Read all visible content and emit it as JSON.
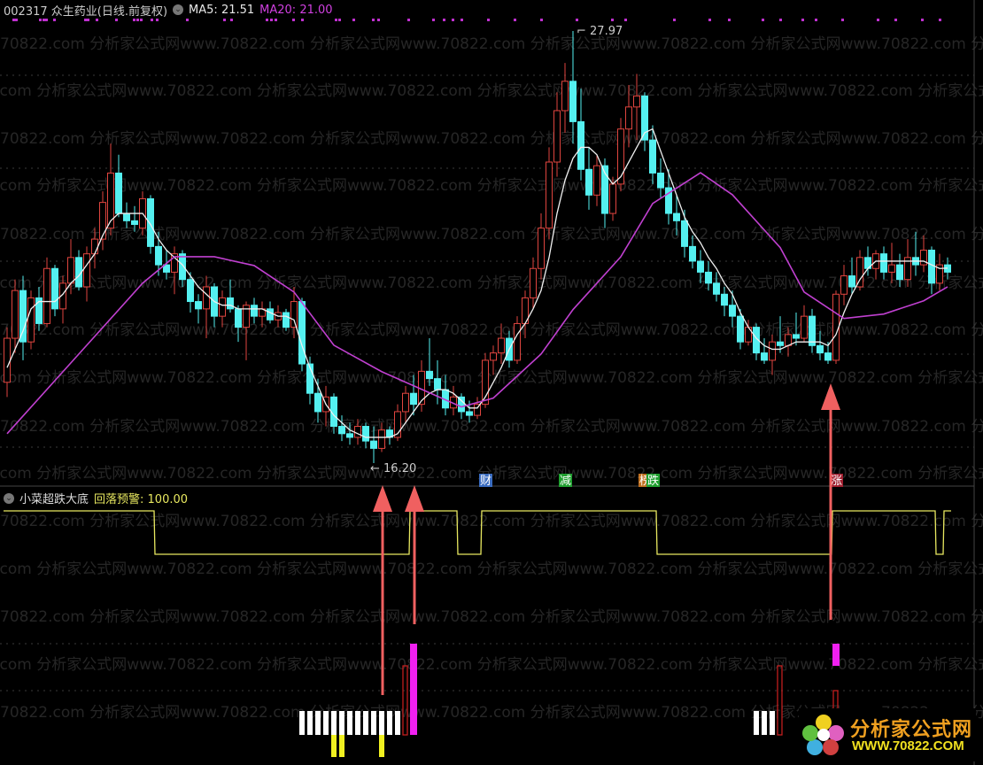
{
  "header": {
    "stock_title": "002317 众生药业(日线.前复权)",
    "ma5_label": "MA5: 21.51",
    "ma20_label": "MA20: 21.00"
  },
  "indicator": {
    "name": "小菜超跌大底",
    "value_label": "回落预警: 100.00"
  },
  "watermark": "70822.com 分析家公式网www.70822.com 分析家公式网www.70822.com 分析家公式网www.70822.com 分析家公式网www.70822.com 分析家公式网",
  "logo": {
    "title": "分析家公式网",
    "url": "WWW.70822.COM"
  },
  "colors": {
    "up": "#e0453f",
    "down": "#54f0f0",
    "ma5": "#f0f0f0",
    "ma20": "#c040d0",
    "alert": "#e8e860",
    "arrow": "#f06060",
    "magenta": "#f020f0"
  },
  "chart_data": {
    "type": "candlestick",
    "title": "002317 众生药业(日线.前复权)",
    "high_label": "27.97",
    "low_label": "16.20",
    "high_index": 71,
    "low_index": 46,
    "candles_ohlc": [
      [
        18.4,
        19.9,
        18.0,
        19.6
      ],
      [
        19.6,
        21.2,
        19.2,
        20.9
      ],
      [
        20.9,
        21.3,
        19.0,
        19.5
      ],
      [
        19.5,
        20.9,
        19.3,
        20.7
      ],
      [
        20.7,
        21.0,
        19.8,
        20.0
      ],
      [
        20.0,
        21.8,
        19.9,
        21.5
      ],
      [
        21.5,
        21.6,
        20.2,
        20.4
      ],
      [
        20.4,
        21.3,
        20.0,
        21.1
      ],
      [
        21.1,
        22.3,
        20.8,
        21.8
      ],
      [
        21.8,
        22.0,
        20.9,
        21.0
      ],
      [
        21.0,
        22.1,
        20.6,
        21.9
      ],
      [
        21.9,
        22.6,
        21.5,
        22.3
      ],
      [
        22.3,
        23.6,
        22.0,
        23.3
      ],
      [
        22.6,
        24.9,
        22.4,
        24.1
      ],
      [
        24.1,
        24.6,
        22.9,
        23.0
      ],
      [
        23.0,
        23.3,
        22.6,
        22.8
      ],
      [
        22.8,
        23.2,
        22.5,
        22.7
      ],
      [
        22.6,
        23.6,
        22.4,
        23.4
      ],
      [
        23.4,
        23.5,
        21.9,
        22.1
      ],
      [
        22.1,
        22.5,
        21.3,
        21.6
      ],
      [
        21.6,
        22.0,
        21.2,
        21.4
      ],
      [
        21.4,
        22.1,
        20.8,
        21.9
      ],
      [
        21.9,
        22.0,
        21.0,
        21.2
      ],
      [
        21.2,
        21.4,
        20.3,
        20.6
      ],
      [
        20.6,
        20.8,
        20.0,
        20.4
      ],
      [
        20.4,
        21.3,
        19.6,
        21.0
      ],
      [
        21.0,
        21.1,
        19.9,
        20.2
      ],
      [
        20.2,
        20.9,
        19.9,
        20.7
      ],
      [
        20.7,
        21.2,
        20.3,
        20.4
      ],
      [
        20.4,
        20.5,
        19.5,
        19.9
      ],
      [
        19.9,
        20.6,
        19.0,
        20.5
      ],
      [
        20.5,
        20.7,
        20.0,
        20.2
      ],
      [
        20.2,
        20.6,
        19.9,
        20.4
      ],
      [
        20.4,
        20.6,
        20.0,
        20.1
      ],
      [
        20.1,
        20.5,
        19.9,
        20.3
      ],
      [
        20.3,
        20.4,
        19.8,
        19.9
      ],
      [
        19.9,
        21.0,
        19.6,
        20.6
      ],
      [
        20.6,
        20.7,
        18.7,
        18.9
      ],
      [
        18.9,
        19.1,
        17.8,
        18.1
      ],
      [
        18.1,
        18.5,
        17.3,
        17.6
      ],
      [
        17.6,
        18.3,
        17.2,
        18.0
      ],
      [
        18.0,
        18.1,
        17.0,
        17.2
      ],
      [
        17.2,
        17.5,
        16.8,
        17.0
      ],
      [
        17.0,
        17.3,
        16.7,
        16.9
      ],
      [
        16.9,
        17.4,
        16.7,
        17.2
      ],
      [
        17.2,
        17.3,
        16.6,
        16.8
      ],
      [
        16.8,
        17.2,
        16.2,
        16.6
      ],
      [
        16.6,
        17.3,
        16.5,
        17.1
      ],
      [
        17.1,
        17.2,
        16.7,
        16.9
      ],
      [
        16.9,
        17.8,
        16.8,
        17.6
      ],
      [
        17.6,
        18.3,
        17.3,
        18.1
      ],
      [
        18.1,
        18.6,
        17.5,
        17.8
      ],
      [
        17.8,
        19.0,
        17.6,
        18.7
      ],
      [
        18.7,
        19.6,
        18.3,
        18.5
      ],
      [
        18.5,
        19.0,
        17.8,
        18.2
      ],
      [
        18.2,
        18.6,
        17.5,
        17.7
      ],
      [
        17.7,
        18.3,
        17.5,
        18.0
      ],
      [
        18.0,
        18.1,
        17.4,
        17.6
      ],
      [
        17.6,
        17.9,
        17.3,
        17.5
      ],
      [
        17.5,
        18.0,
        17.4,
        17.8
      ],
      [
        17.8,
        19.2,
        17.7,
        19.0
      ],
      [
        19.0,
        19.4,
        18.6,
        19.2
      ],
      [
        19.2,
        20.0,
        18.9,
        19.6
      ],
      [
        19.6,
        19.8,
        18.8,
        19.0
      ],
      [
        19.0,
        20.2,
        18.9,
        20.0
      ],
      [
        20.0,
        20.9,
        19.6,
        20.7
      ],
      [
        20.7,
        21.8,
        20.4,
        21.5
      ],
      [
        21.5,
        23.0,
        21.2,
        22.6
      ],
      [
        22.6,
        24.8,
        22.3,
        24.4
      ],
      [
        24.4,
        26.3,
        24.0,
        25.8
      ],
      [
        25.8,
        27.1,
        25.2,
        26.6
      ],
      [
        26.6,
        27.97,
        24.9,
        25.5
      ],
      [
        25.5,
        26.4,
        23.9,
        24.2
      ],
      [
        24.2,
        24.8,
        23.1,
        23.5
      ],
      [
        23.5,
        24.6,
        23.2,
        24.3
      ],
      [
        24.3,
        24.5,
        22.6,
        23.0
      ],
      [
        23.0,
        24.0,
        22.8,
        23.8
      ],
      [
        23.8,
        25.6,
        23.6,
        25.3
      ],
      [
        25.3,
        26.5,
        24.8,
        25.9
      ],
      [
        25.9,
        26.8,
        25.0,
        26.2
      ],
      [
        26.2,
        26.3,
        24.7,
        25.0
      ],
      [
        25.0,
        25.4,
        23.8,
        24.1
      ],
      [
        24.1,
        24.5,
        23.4,
        23.7
      ],
      [
        23.7,
        24.2,
        22.7,
        23.0
      ],
      [
        23.0,
        23.5,
        22.4,
        22.8
      ],
      [
        22.8,
        23.1,
        21.8,
        22.1
      ],
      [
        22.1,
        22.4,
        21.5,
        21.7
      ],
      [
        21.7,
        22.0,
        21.1,
        21.4
      ],
      [
        21.4,
        21.7,
        20.9,
        21.1
      ],
      [
        21.1,
        21.4,
        20.6,
        20.8
      ],
      [
        20.8,
        21.0,
        20.2,
        20.5
      ],
      [
        20.5,
        20.9,
        19.9,
        20.2
      ],
      [
        20.2,
        20.4,
        19.3,
        19.5
      ],
      [
        19.5,
        20.1,
        19.4,
        19.9
      ],
      [
        19.9,
        20.0,
        19.0,
        19.2
      ],
      [
        19.2,
        19.6,
        18.9,
        19.0
      ],
      [
        19.0,
        19.7,
        18.6,
        19.5
      ],
      [
        19.5,
        20.2,
        19.2,
        19.4
      ],
      [
        19.4,
        19.9,
        19.1,
        19.7
      ],
      [
        19.7,
        20.3,
        19.4,
        19.6
      ],
      [
        19.6,
        20.5,
        19.5,
        20.2
      ],
      [
        20.2,
        20.4,
        19.2,
        19.4
      ],
      [
        19.4,
        19.8,
        19.0,
        19.2
      ],
      [
        19.2,
        19.5,
        18.9,
        19.0
      ],
      [
        19.0,
        20.9,
        18.9,
        20.8
      ],
      [
        20.8,
        21.6,
        20.5,
        21.3
      ],
      [
        21.3,
        21.8,
        20.8,
        21.0
      ],
      [
        21.0,
        22.0,
        20.9,
        21.8
      ],
      [
        21.8,
        22.1,
        21.3,
        21.5
      ],
      [
        21.5,
        22.0,
        21.2,
        21.9
      ],
      [
        21.9,
        22.1,
        21.2,
        21.4
      ],
      [
        21.4,
        22.2,
        21.1,
        21.6
      ],
      [
        21.6,
        21.9,
        21.0,
        21.2
      ],
      [
        21.2,
        22.3,
        21.0,
        21.8
      ],
      [
        21.8,
        22.5,
        21.3,
        21.6
      ],
      [
        21.6,
        22.4,
        21.4,
        22.0
      ],
      [
        22.0,
        22.1,
        20.8,
        21.1
      ],
      [
        21.1,
        21.9,
        20.9,
        21.6
      ],
      [
        21.6,
        21.8,
        21.2,
        21.4
      ]
    ],
    "ma5": [
      18.8,
      19.3,
      19.8,
      20.4,
      20.6,
      20.6,
      20.6,
      20.8,
      21.1,
      21.3,
      21.6,
      21.9,
      22.4,
      22.8,
      23.0,
      23.0,
      23.0,
      23.0,
      22.7,
      22.3,
      22.0,
      21.8,
      21.6,
      21.3,
      21.0,
      20.8,
      20.6,
      20.5,
      20.5,
      20.4,
      20.4,
      20.4,
      20.4,
      20.3,
      20.2,
      20.2,
      20.1,
      19.4,
      18.8,
      18.3,
      17.8,
      17.5,
      17.3,
      17.1,
      17.0,
      16.9,
      16.9,
      16.9,
      16.9,
      17.0,
      17.3,
      17.6,
      17.9,
      18.1,
      18.2,
      18.2,
      18.1,
      17.9,
      17.7,
      17.7,
      18.0,
      18.4,
      18.8,
      19.3,
      19.7,
      20.0,
      20.4,
      20.9,
      21.8,
      23.0,
      23.9,
      24.5,
      24.8,
      24.8,
      24.6,
      24.1,
      23.8,
      24.0,
      24.4,
      24.8,
      25.2,
      25.3,
      24.7,
      24.1,
      23.5,
      22.9,
      22.5,
      22.2,
      21.8,
      21.5,
      21.1,
      20.8,
      20.3,
      19.9,
      19.6,
      19.4,
      19.3,
      19.3,
      19.4,
      19.5,
      19.5,
      19.5,
      19.5,
      19.4,
      19.7,
      20.3,
      20.8,
      21.2,
      21.5,
      21.7,
      21.7,
      21.7,
      21.7,
      21.7,
      21.7,
      21.7,
      21.6,
      21.5,
      21.51
    ],
    "ma20_knots": [
      [
        0,
        17.0
      ],
      [
        10,
        19.41
      ],
      [
        17,
        21.1
      ],
      [
        21,
        21.82
      ],
      [
        26,
        21.82
      ],
      [
        31,
        21.58
      ],
      [
        36,
        20.86
      ],
      [
        41,
        19.41
      ],
      [
        47,
        18.69
      ],
      [
        52,
        18.21
      ],
      [
        57,
        17.73
      ],
      [
        61,
        17.97
      ],
      [
        67,
        19.17
      ],
      [
        71,
        20.38
      ],
      [
        77,
        21.82
      ],
      [
        81,
        23.27
      ],
      [
        87,
        24.11
      ],
      [
        91,
        23.51
      ],
      [
        97,
        22.07
      ],
      [
        100,
        20.86
      ],
      [
        105,
        20.14
      ],
      [
        110,
        20.26
      ],
      [
        115,
        20.62
      ],
      [
        118,
        21.0
      ]
    ],
    "signals": [
      {
        "index": 60,
        "text": "财",
        "color": "#3a6cc0"
      },
      {
        "index": 70,
        "text": "减",
        "color": "#20a030"
      },
      {
        "index": 80,
        "text": "榜",
        "color": "#c07020"
      },
      {
        "index": 81,
        "text": "跌",
        "color": "#20a030"
      },
      {
        "index": 104,
        "text": "涨",
        "color": "#a02030"
      }
    ],
    "alert_line": [
      1,
      1,
      1,
      1,
      1,
      1,
      1,
      1,
      1,
      1,
      1,
      1,
      1,
      1,
      1,
      1,
      1,
      1,
      1,
      0,
      0,
      0,
      0,
      0,
      0,
      0,
      0,
      0,
      0,
      0,
      0,
      0,
      0,
      0,
      0,
      0,
      0,
      0,
      0,
      0,
      0,
      0,
      0,
      0,
      0,
      0,
      0,
      0,
      0,
      0,
      0,
      1,
      1,
      1,
      1,
      1,
      1,
      0,
      0,
      0,
      1,
      1,
      1,
      1,
      1,
      1,
      1,
      1,
      1,
      1,
      1,
      1,
      1,
      1,
      1,
      1,
      1,
      1,
      1,
      1,
      1,
      1,
      0,
      0,
      0,
      0,
      0,
      0,
      0,
      0,
      0,
      0,
      0,
      0,
      0,
      0,
      0,
      0,
      0,
      0,
      0,
      0,
      0,
      0,
      1,
      1,
      1,
      1,
      1,
      1,
      1,
      1,
      1,
      1,
      1,
      1,
      1,
      0,
      1
    ],
    "white_bars": [
      37,
      38,
      39,
      40,
      41,
      42,
      43,
      44,
      45,
      46,
      47,
      48,
      49,
      94,
      95,
      96
    ],
    "yellow_bars": [
      41,
      42,
      47
    ],
    "red_bars": [
      {
        "index": 50,
        "level": 3
      },
      {
        "index": 97,
        "level": 3
      },
      {
        "index": 104,
        "level": 2
      }
    ],
    "magenta_bars": [
      {
        "index": 51,
        "from": 0,
        "to": 4
      },
      {
        "index": 104,
        "from": 3,
        "to": 4
      }
    ],
    "arrows": [
      {
        "index": 47,
        "top": "price"
      },
      {
        "index": 51,
        "top": "price"
      },
      {
        "index": 103,
        "top": "price"
      }
    ]
  }
}
